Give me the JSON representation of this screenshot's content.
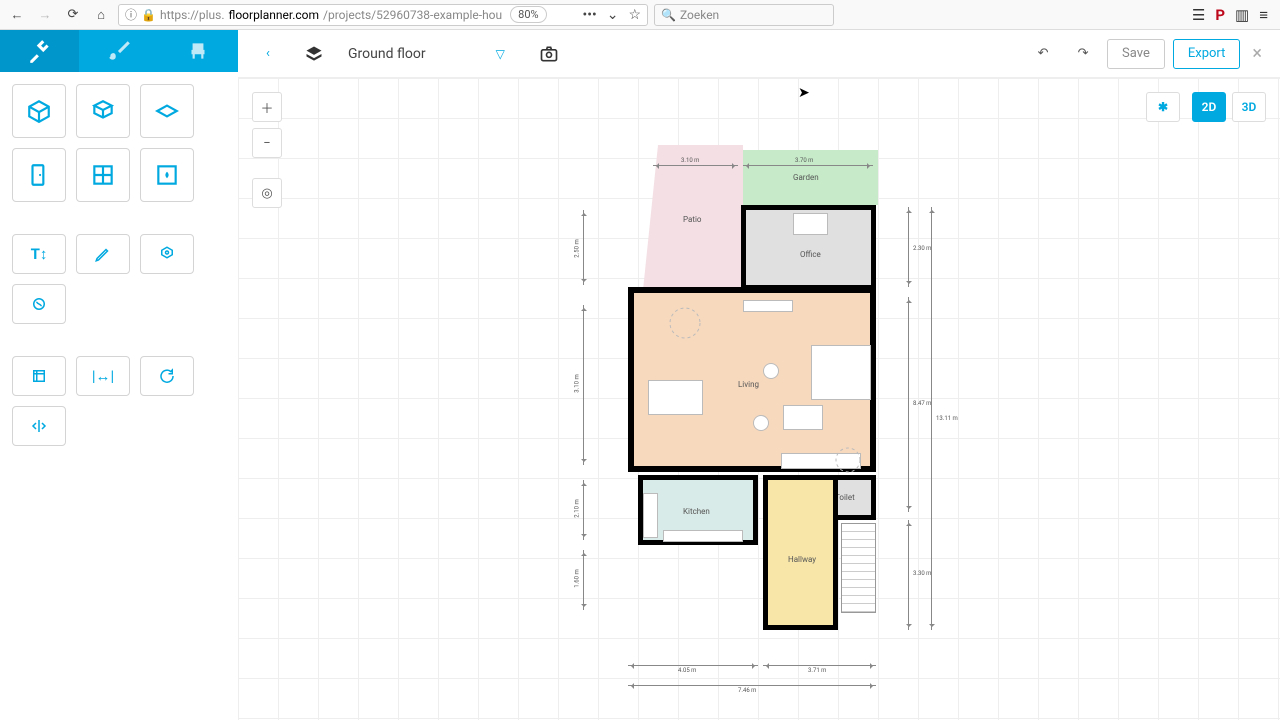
{
  "browser": {
    "url_display": "https://plus.floorplanner.com/projects/52960738-example-hou",
    "url_domain": "floorplanner.com",
    "zoom": "80%",
    "search_placeholder": "Zoeken"
  },
  "topbar": {
    "floor_name": "Ground floor",
    "save_label": "Save",
    "export_label": "Export"
  },
  "view": {
    "btn_2d": "2D",
    "btn_3d": "3D"
  },
  "rooms": {
    "garden": "Garden",
    "patio": "Patio",
    "office": "Office",
    "living": "Living",
    "kitchen": "Kitchen",
    "toilet": "Toilet",
    "hallway": "Hallway"
  },
  "dimensions": {
    "top1": "3.10 m",
    "top2": "3.70 m",
    "left1": "2.50 m",
    "left2": "3.10 m",
    "left3": "2.10 m",
    "left4": "1.60 m",
    "right1": "2.30 m",
    "right2": "8.47 m",
    "right3": "3.30 m",
    "right_total": "13.11 m",
    "bottom1": "4.05 m",
    "bottom2": "3.71 m",
    "bottom_total": "7.46 m"
  }
}
